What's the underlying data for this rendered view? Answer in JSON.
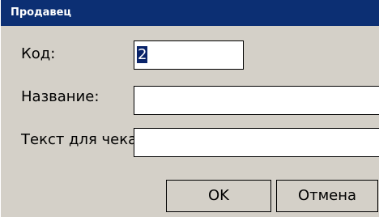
{
  "window": {
    "title": "Продавец"
  },
  "form": {
    "code_label": "Код:",
    "code_value": "2",
    "name_label": "Название:",
    "name_value": "",
    "receipt_label": "Текст для чека:",
    "receipt_value": ""
  },
  "buttons": {
    "ok_label": "OK",
    "cancel_label": "Отмена"
  },
  "colors": {
    "titlebar": "#0c2f73",
    "dialog_bg": "#d4d0c8",
    "selection": "#0a246a"
  }
}
